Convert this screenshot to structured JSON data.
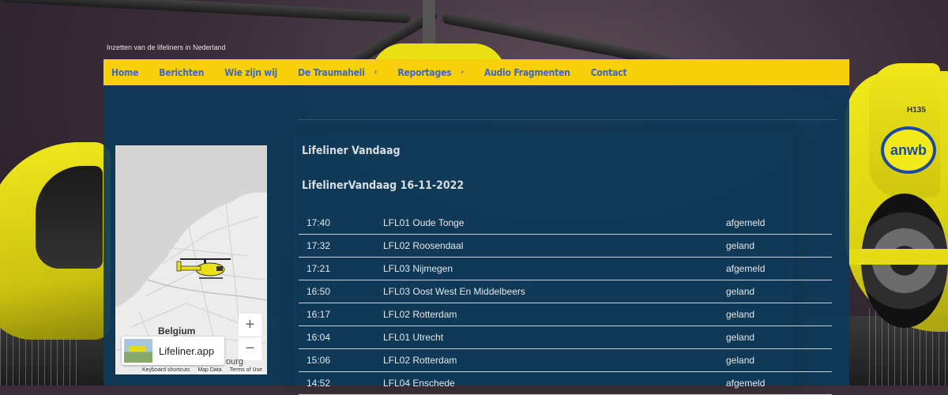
{
  "site": {
    "tagline": "Inzetten van de lifeliners in Nederland"
  },
  "nav": {
    "items": [
      {
        "label": "Home",
        "submenu": false
      },
      {
        "label": "Berichten",
        "submenu": false
      },
      {
        "label": "Wie zijn wij",
        "submenu": false
      },
      {
        "label": "De Traumaheli",
        "submenu": true
      },
      {
        "label": "Reportages",
        "submenu": true
      },
      {
        "label": "Audio Fragmenten",
        "submenu": false
      },
      {
        "label": "Contact",
        "submenu": false
      }
    ],
    "caret": "›",
    "colors": {
      "bar": "#f7cf0a",
      "text": "#3e68c4"
    }
  },
  "map": {
    "zoom_in": "+",
    "zoom_out": "−",
    "label_country": "Belgium",
    "label_partial": "ourg",
    "app_name": "Lifeliner.app",
    "footer": [
      "Keyboard shortcuts",
      "Map Data",
      "Terms of Use"
    ],
    "icons": {
      "helicopter": "helicopter-icon",
      "zoom_in": "plus-icon",
      "zoom_out": "minus-icon"
    }
  },
  "main": {
    "section_title": "Lifeliner Vandaag",
    "date_heading": "LifelinerVandaag 16-11-2022",
    "rows": [
      {
        "time": "17:40",
        "flight": "LFL01 Oude Tonge",
        "status": "afgemeld"
      },
      {
        "time": "17:32",
        "flight": "LFL02 Roosendaal",
        "status": "geland"
      },
      {
        "time": "17:21",
        "flight": "LFL03 Nijmegen",
        "status": "afgemeld"
      },
      {
        "time": "16:50",
        "flight": "LFL03 Oost West En Middelbeers",
        "status": "geland"
      },
      {
        "time": "16:17",
        "flight": "LFL02 Rotterdam",
        "status": "geland"
      },
      {
        "time": "16:04",
        "flight": "LFL01 Utrecht",
        "status": "geland"
      },
      {
        "time": "15:06",
        "flight": "LFL02 Rotterdam",
        "status": "geland"
      },
      {
        "time": "14:52",
        "flight": "LFL04 Enschede",
        "status": "afgemeld"
      }
    ]
  }
}
